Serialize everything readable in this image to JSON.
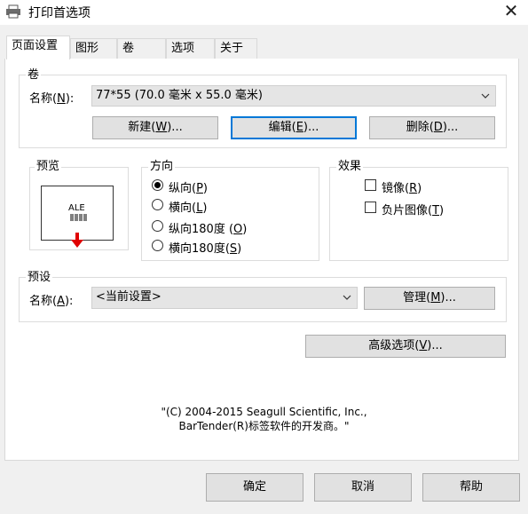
{
  "window": {
    "title": "打印首选项",
    "close_glyph": "✕"
  },
  "tabs": [
    {
      "label": "页面设置",
      "active": true
    },
    {
      "label": "图形"
    },
    {
      "label": "卷"
    },
    {
      "label": "选项"
    },
    {
      "label": "关于"
    }
  ],
  "roll_group": {
    "title": "卷",
    "name_label": "名称(",
    "name_key": "N",
    "name_suffix": "):",
    "name_value": "77*55 (70.0 毫米 x 55.0 毫米)",
    "buttons": {
      "new_pre": "新建(",
      "new_key": "W",
      "new_post": ")...",
      "edit_pre": "编辑(",
      "edit_key": "E",
      "edit_post": ")...",
      "delete_pre": "删除(",
      "delete_key": "D",
      "delete_post": ")..."
    }
  },
  "preview_group": {
    "title": "预览",
    "label_text": "ALE"
  },
  "orientation_group": {
    "title": "方向",
    "options": [
      {
        "pre": "纵向(",
        "key": "P",
        "post": ")",
        "selected": true
      },
      {
        "pre": "横向(",
        "key": "L",
        "post": ")",
        "selected": false
      },
      {
        "pre": "纵向180度 (",
        "key": "O",
        "post": ")",
        "selected": false
      },
      {
        "pre": "横向180度(",
        "key": "S",
        "post": ")",
        "selected": false
      }
    ]
  },
  "effects_group": {
    "title": "效果",
    "options": [
      {
        "pre": "镜像(",
        "key": "R",
        "post": ")",
        "checked": false
      },
      {
        "pre": "负片图像(",
        "key": "T",
        "post": ")",
        "checked": false
      }
    ]
  },
  "preset_group": {
    "title": "预设",
    "name_label": "名称(",
    "name_key": "A",
    "name_suffix": "):",
    "name_value": "<当前设置>",
    "manage_pre": "管理(",
    "manage_key": "M",
    "manage_post": ")..."
  },
  "advanced_button": {
    "pre": "高级选项(",
    "key": "V",
    "post": ")..."
  },
  "copyright": {
    "line1": "\"(C) 2004-2015 Seagull Scientific, Inc.,",
    "line2": "BarTender(R)标签软件的开发商。\""
  },
  "footer_buttons": {
    "ok": "确定",
    "cancel": "取消",
    "help": "帮助"
  },
  "colors": {
    "focus_border": "#0078d7",
    "arrow": "#e00000"
  }
}
